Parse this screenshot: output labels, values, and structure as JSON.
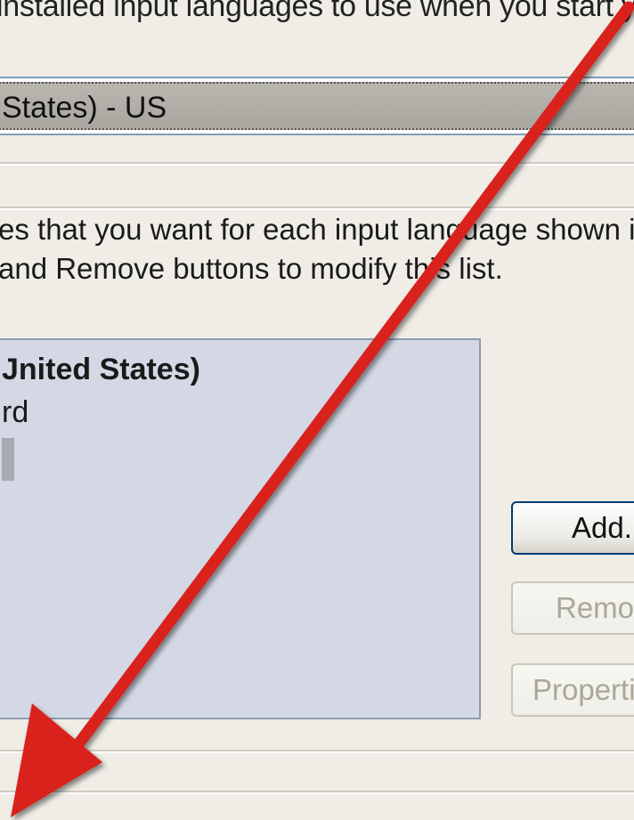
{
  "header": {
    "instruction_text": "installed input languages to use when you start y"
  },
  "default_language": {
    "selected_value": "States) - US"
  },
  "installed_services": {
    "description_line1": "es that you want for each input language shown i",
    "description_line2": "and Remove buttons to modify this list.",
    "tree": {
      "language": "Jnited States)",
      "item": "rd"
    }
  },
  "buttons": {
    "add_label": "Add.",
    "remove_label": "Remov",
    "properties_label": "Properti"
  },
  "annotation": {
    "arrow_color": "#d9201c"
  }
}
